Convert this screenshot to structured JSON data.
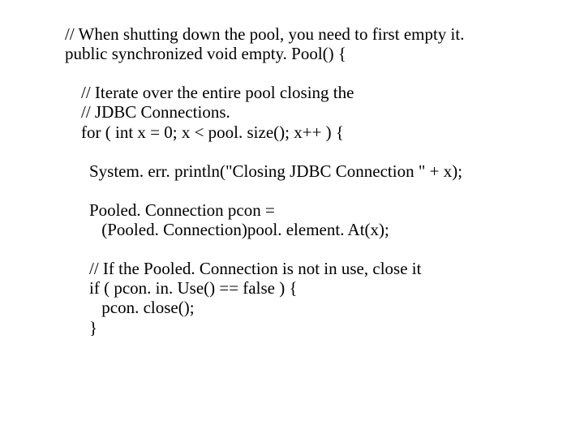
{
  "lines": {
    "l0": "// When shutting down the pool, you need to first empty it.",
    "l1": "public synchronized void empty. Pool() {",
    "l2": "// Iterate over the entire pool closing the",
    "l3": "// JDBC Connections.",
    "l4": "for ( int x = 0; x < pool. size(); x++ ) {",
    "l5": "System. err. println(\"Closing JDBC Connection \" + x);",
    "l6": "Pooled. Connection pcon =",
    "l7": " (Pooled. Connection)pool. element. At(x);",
    "l8": "// If the Pooled. Connection is not in use, close it",
    "l9": "if ( pcon. in. Use() == false ) {",
    "l10": " pcon. close();",
    "l11": "}"
  }
}
